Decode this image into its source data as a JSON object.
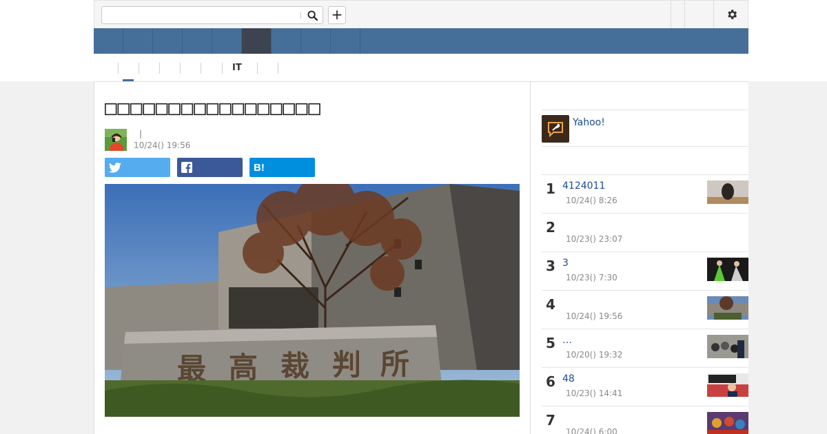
{
  "search": {
    "placeholder": "",
    "value": ""
  },
  "toolbar": {
    "plus_label": "+"
  },
  "subnav": {
    "items": [
      "",
      "",
      "",
      "",
      "",
      "IT",
      "",
      ""
    ]
  },
  "article": {
    "title": "□□□□□□□□□□□□□□□□□",
    "author_sep": "|",
    "date": "10/24() 19:56"
  },
  "sponsor": {
    "link_text": "Yahoo!"
  },
  "ranking": [
    {
      "rank": "1",
      "title": "4124011",
      "date": "10/24() 8:26",
      "thumb": "portrait"
    },
    {
      "rank": "2",
      "title": "",
      "date": "10/23() 23:07",
      "thumb": ""
    },
    {
      "rank": "3",
      "title": "3",
      "date": "10/23() 7:30",
      "thumb": "stage"
    },
    {
      "rank": "4",
      "title": "",
      "date": "10/24() 19:56",
      "thumb": "building"
    },
    {
      "rank": "5",
      "title": "…",
      "date": "10/20() 19:32",
      "thumb": "crowd"
    },
    {
      "rank": "6",
      "title": "48",
      "date": "10/23() 14:41",
      "thumb": "politics"
    },
    {
      "rank": "7",
      "title": "",
      "date": "10/24() 6:00",
      "thumb": "festival"
    }
  ],
  "colors": {
    "nav": "#456f98",
    "nav_active": "#3d4350",
    "twitter": "#55acee",
    "facebook": "#3b5998",
    "hatena": "#008fde",
    "link": "#1a4b8f"
  },
  "icons": {
    "search": "search-icon",
    "settings": "gear-icon",
    "twitter": "twitter-icon",
    "facebook": "facebook-icon",
    "hatena": "hatena-bookmark-icon",
    "sponsor": "feather-speech-icon"
  }
}
